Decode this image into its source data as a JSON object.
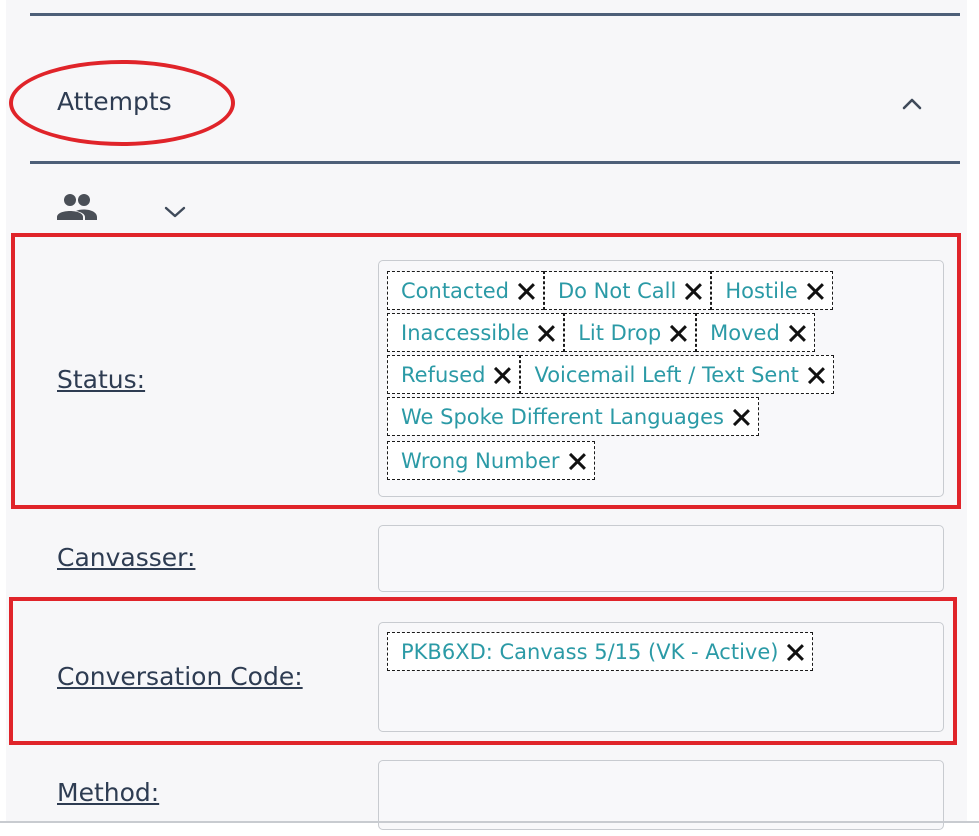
{
  "section": {
    "title": "Attempts"
  },
  "fields": {
    "status": {
      "label": "Status:",
      "tags": [
        "Contacted",
        "Do Not Call",
        "Hostile",
        "Inaccessible",
        "Lit Drop",
        "Moved",
        "Refused",
        "Voicemail Left / Text Sent",
        "We Spoke Different Languages",
        "Wrong Number"
      ]
    },
    "canvasser": {
      "label": "Canvasser:",
      "value": ""
    },
    "conversation_code": {
      "label": "Conversation Code:",
      "tags": [
        "PKB6XD: Canvass 5/15 (VK - Active)"
      ]
    },
    "method": {
      "label": "Method:",
      "value": ""
    }
  },
  "icons": {
    "collapse": "chevron-up-icon",
    "people": "people-icon",
    "dropdown": "chevron-down-icon",
    "remove": "close-icon"
  },
  "colors": {
    "tag_text": "#2b9aa6",
    "label_text": "#2e3c52",
    "annotation": "#e0242a",
    "divider": "#4d5f78"
  }
}
